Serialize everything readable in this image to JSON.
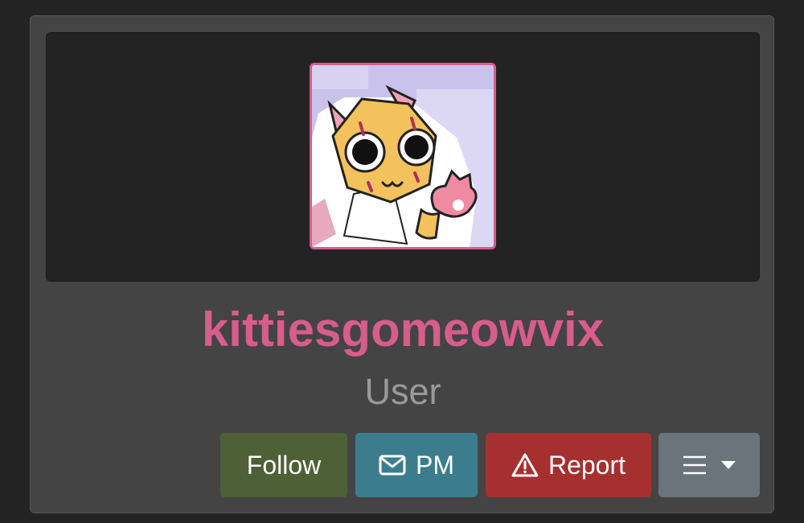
{
  "profile": {
    "username": "kittiesgomeowvix",
    "role": "User",
    "avatar_icon": "cat-avatar-icon"
  },
  "actions": {
    "follow_label": "Follow",
    "pm_label": "PM",
    "report_label": "Report"
  },
  "icons": {
    "pm": "envelope-icon",
    "report": "warning-triangle-icon",
    "menu": "hamburger-menu-icon",
    "caret": "caret-down-icon"
  },
  "colors": {
    "username": "#d75d8b",
    "role": "#9a9a9a",
    "follow": "#4e6035",
    "pm": "#3b7d8d",
    "report": "#a6302f",
    "menu": "#6b737b"
  }
}
